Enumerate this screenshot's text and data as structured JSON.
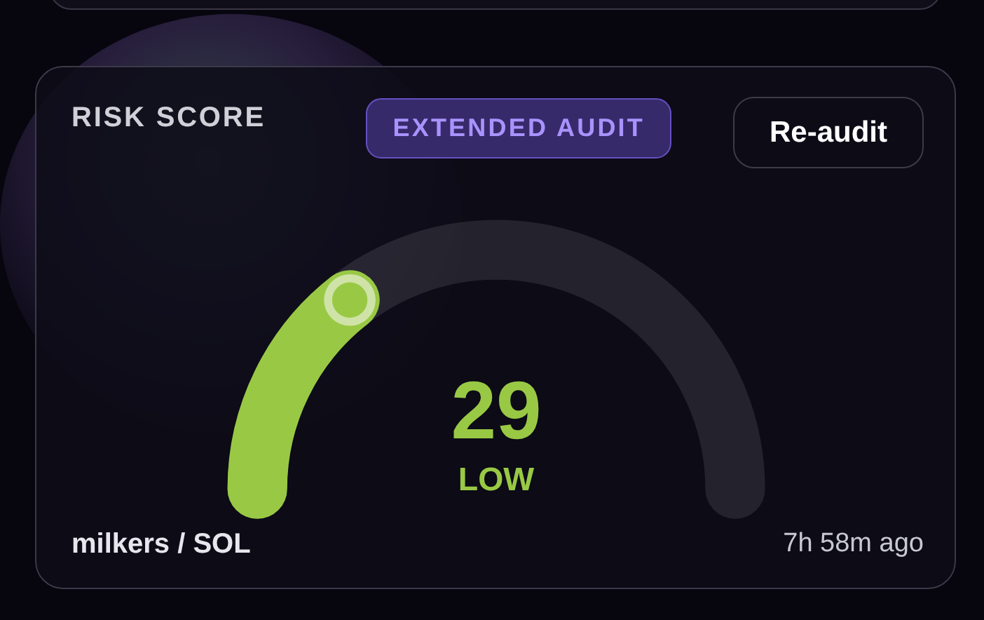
{
  "card": {
    "title": "RISK SCORE",
    "badge": "EXTENDED AUDIT",
    "button": "Re-audit",
    "gauge": {
      "level": 0.29,
      "score": "29",
      "rating": "LOW"
    },
    "pair": "milkers / SOL",
    "updated": "7h 58m ago"
  }
}
